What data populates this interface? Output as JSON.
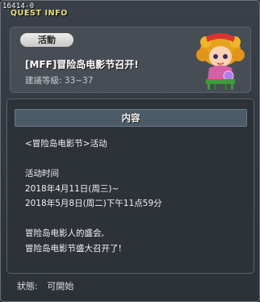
{
  "window": {
    "quest_id": "16414-0",
    "title": "QUEST INFO"
  },
  "quest": {
    "tag": "活動",
    "title": "[MFF]冒险岛电影节召开!",
    "level_label": "建議等級:",
    "level_value": "33~37"
  },
  "content": {
    "header": "内容",
    "lines": [
      "<冒险岛电影节>活动",
      "",
      "活动时间",
      "2018年4月11日(周三)~",
      "2018年5月8日(周二)下午11点59分",
      "",
      "冒险岛电影人的盛会,",
      "冒险岛电影节盛大召开了!"
    ]
  },
  "status": {
    "label": "狀態:",
    "value": "可開始"
  },
  "icons": {
    "npc_portrait": "npc-portrait-icon"
  }
}
